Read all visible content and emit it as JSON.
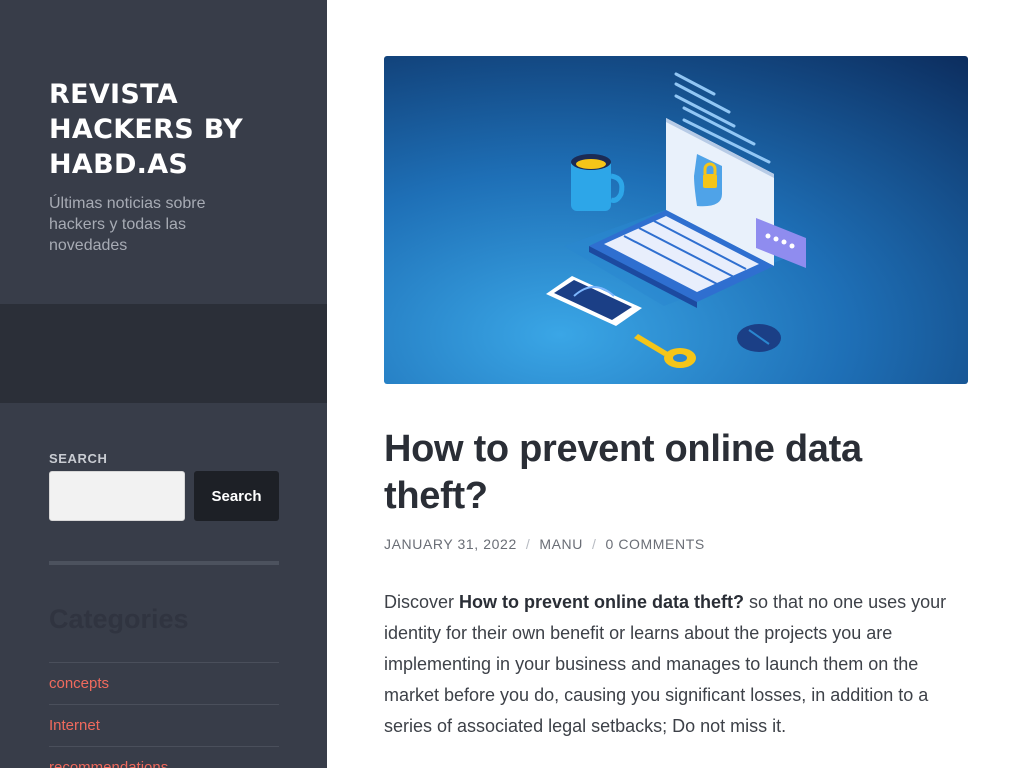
{
  "site": {
    "title": "REVISTA HACKERS BY HABD.AS",
    "description": "Últimas noticias sobre hackers y todas las novedades"
  },
  "search_widget": {
    "label": "SEARCH",
    "placeholder": "",
    "button_label": "Search"
  },
  "categories": {
    "title": "Categories",
    "items": [
      {
        "label": "concepts"
      },
      {
        "label": "Internet"
      },
      {
        "label": "recommendations"
      }
    ]
  },
  "post": {
    "title": "How to prevent online data theft?",
    "meta": {
      "date": "JANUARY 31, 2022",
      "separator": "/",
      "author": "MANU",
      "comments": "0 COMMENTS"
    },
    "excerpt": {
      "lead": "Discover ",
      "bold": "How to prevent online data theft?",
      "rest": " so that no one uses your identity for their own benefit or learns about the projects you are implementing in your business and manages to launch them on the market before you do, causing you significant losses, in addition to a series of associated legal setbacks; Do not miss it."
    },
    "image_icon": "laptop-security-illustration"
  },
  "colors": {
    "sidebar_bg": "#383d49",
    "sidebar_dark_band": "#2b2f38",
    "accent_link": "#f06a5d",
    "button_bg": "#1d2026"
  }
}
